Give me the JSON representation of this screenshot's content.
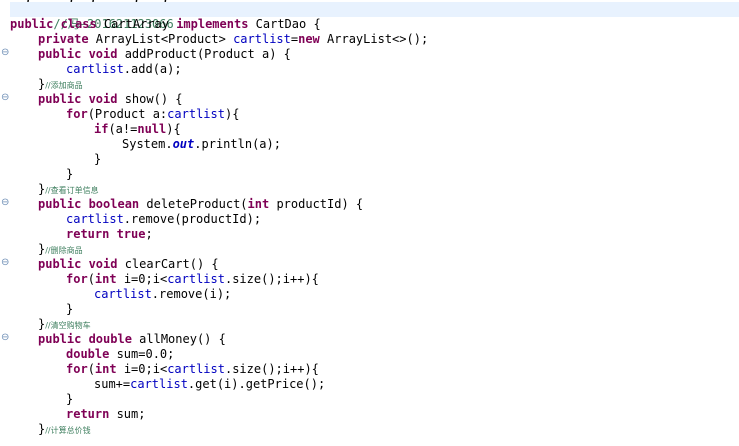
{
  "editor": {
    "colors": {
      "keyword": "#7f0055",
      "field": "#0000c0",
      "comment": "#3f7f5f",
      "current_line": "#e8f2fe",
      "fold_marker": "#6c8db5"
    },
    "fold_icon": "minus-circle-icon",
    "lines": [
      {
        "comment": "//冯—201621123066"
      },
      {
        "kw1": "public class",
        "text1": " CartArray ",
        "kw2": "implements",
        "text2": " CartDao {"
      },
      {
        "kw1": "private",
        "text1": " ArrayList<Product> ",
        "field": "cartlist",
        "text2": "=",
        "kw2": "new",
        "text3": " ArrayList<>();"
      },
      {
        "kw1": "public void",
        "text1": " addProduct(Product a) {"
      },
      {
        "field": "cartlist",
        "text1": ".add(a);"
      },
      {
        "text1": "}",
        "comment": "//添加商品"
      },
      {
        "kw1": "public void",
        "text1": " show() {"
      },
      {
        "kw1": "for",
        "text1": "(Product a:",
        "field": "cartlist",
        "text2": "){"
      },
      {
        "kw1": "if",
        "text1": "(a!=",
        "kw2": "null",
        "text2": "){"
      },
      {
        "text1": "System.",
        "static": "out",
        "text2": ".println(a);"
      },
      {
        "text1": "}"
      },
      {
        "text1": "}"
      },
      {
        "text1": "}",
        "comment": "//查看订单信息"
      },
      {
        "kw1": "public boolean",
        "text1": " deleteProduct(",
        "kw2": "int",
        "text2": " productId) {"
      },
      {
        "field": "cartlist",
        "text1": ".remove(productId);"
      },
      {
        "kw1": "return true",
        "text1": ";"
      },
      {
        "text1": "}",
        "comment": "//删除商品"
      },
      {
        "kw1": "public void",
        "text1": " clearCart() {"
      },
      {
        "kw1": "for",
        "text1": "(",
        "kw2": "int",
        "text2": " i=0;i<",
        "field": "cartlist",
        "text3": ".size();i++){"
      },
      {
        "field": "cartlist",
        "text1": ".remove(i);"
      },
      {
        "text1": "}"
      },
      {
        "text1": "}",
        "comment": "//清空购物车"
      },
      {
        "kw1": "public double",
        "text1": " allMoney() {"
      },
      {
        "kw1": "double",
        "text1": " sum=0.0;"
      },
      {
        "kw1": "for",
        "text1": "(",
        "kw2": "int",
        "text2": " i=0;i<",
        "field": "cartlist",
        "text3": ".size();i++){"
      },
      {
        "text1": "sum+=",
        "field": "cartlist",
        "text2": ".get(i).getPrice();"
      },
      {
        "text1": "}"
      },
      {
        "kw1": "return",
        "text1": " sum;"
      },
      {
        "text1": "}",
        "comment": "//计算总价钱"
      }
    ]
  }
}
